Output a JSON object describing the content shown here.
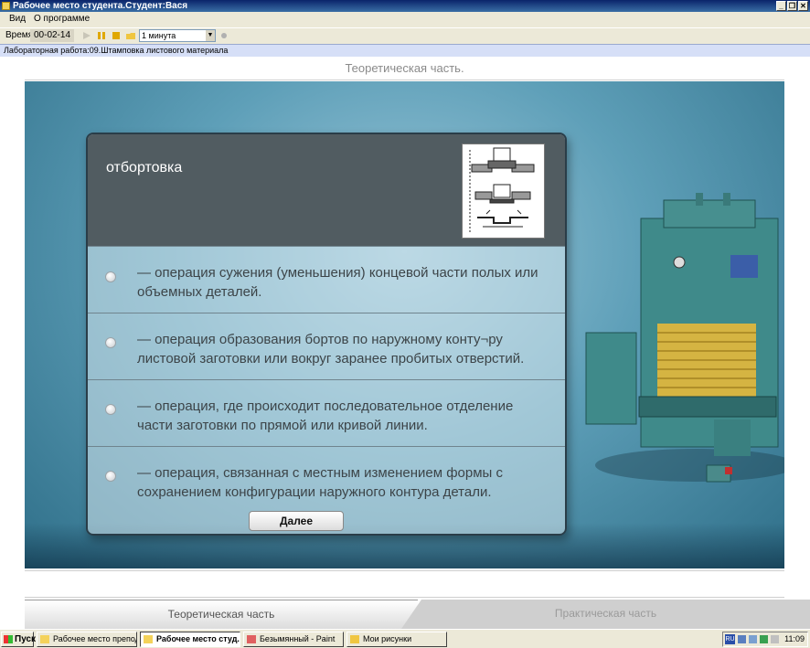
{
  "window": {
    "title": "Рабочее место студента.Студент:Вася",
    "btn_minimize": "_",
    "btn_restore": "❐",
    "btn_close": "✕"
  },
  "menu": [
    "Вид",
    "О программе"
  ],
  "toolbar": {
    "time_label": "Время",
    "time_value": "00-02-14",
    "interval_value": "1 минута"
  },
  "lab_title": "Лабораторная работа:09.Штамповка листового материала",
  "section_title": "Теоретическая часть.",
  "quiz": {
    "term": "отбортовка",
    "options": [
      "— операция сужения (уменьшения) концевой части полых или объемных деталей.",
      "— операция образования бортов по наружному конту¬ру листовой заготовки или вокруг заранее пробитых отверстий.",
      "— операция, где происходит последовательное отделение части заготовки по прямой или кривой линии.",
      "— операция, связанная с местным изменением формы с сохранением конфигурации наружного контура детали."
    ],
    "next_label": "Далее"
  },
  "tabs": {
    "theory": "Теоретическая часть",
    "practice": "Практическая часть"
  },
  "taskbar": {
    "start": "Пуск",
    "items": [
      "Рабочее место препода...",
      "Рабочее место студ...",
      "Безымянный - Paint",
      "Мои рисунки"
    ],
    "lang": "RU",
    "clock": "11:09"
  },
  "colors": {
    "titlebar": "#0a246a",
    "stage": "#5e9fb8",
    "quiz_header": "#515c61",
    "machine": "#3f8a8a"
  }
}
